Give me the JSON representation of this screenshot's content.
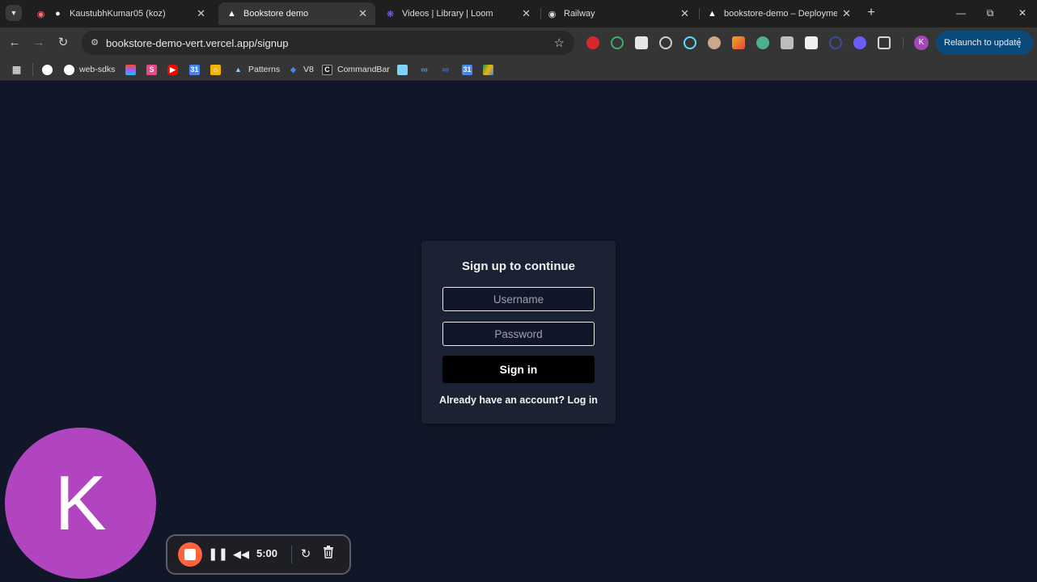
{
  "browser": {
    "tabs": [
      {
        "title": "KaustubhKumar05 (koz)",
        "favicon": "github-icon",
        "active": false
      },
      {
        "title": "Bookstore demo",
        "favicon": "vercel-icon",
        "active": true
      },
      {
        "title": "Videos | Library | Loom",
        "favicon": "loom-icon",
        "active": false
      },
      {
        "title": "Railway",
        "favicon": "railway-icon",
        "active": false
      },
      {
        "title": "bookstore-demo – Deployment",
        "favicon": "vercel-icon",
        "active": false
      }
    ],
    "url": "bookstore-demo-vert.vercel.app/signup",
    "relaunch_label": "Relaunch to update",
    "profile_initial": "K",
    "bookmarks": [
      {
        "label": "",
        "icon": "github-icon"
      },
      {
        "label": "web-sdks",
        "icon": "github-icon"
      },
      {
        "label": "",
        "icon": "figma-icon"
      },
      {
        "label": "",
        "icon": "s-app-icon"
      },
      {
        "label": "",
        "icon": "youtube-icon"
      },
      {
        "label": "",
        "icon": "calendar-icon"
      },
      {
        "label": "",
        "icon": "home-icon"
      },
      {
        "label": "Patterns",
        "icon": "patterns-icon"
      },
      {
        "label": "V8",
        "icon": "v8-icon"
      },
      {
        "label": "CommandBar",
        "icon": "commandbar-icon"
      },
      {
        "label": "",
        "icon": "clipboard-icon"
      },
      {
        "label": "",
        "icon": "infinity-icon"
      },
      {
        "label": "",
        "icon": "loop-icon"
      },
      {
        "label": "",
        "icon": "calendar-icon"
      },
      {
        "label": "",
        "icon": "drive-icon"
      }
    ]
  },
  "signup": {
    "heading": "Sign up to continue",
    "username_placeholder": "Username",
    "password_placeholder": "Password",
    "submit_label": "Sign in",
    "already_text": "Already have an account?",
    "login_link": "Log in"
  },
  "recorder": {
    "camera_initial": "K",
    "time": "5:00"
  },
  "colors": {
    "page_bg": "#111728",
    "card_bg": "#1b2233",
    "button_bg": "#000000",
    "camera_bubble": "#b145bf",
    "record_stop": "#ff623d",
    "relaunch_bg": "#0a4a7a"
  }
}
